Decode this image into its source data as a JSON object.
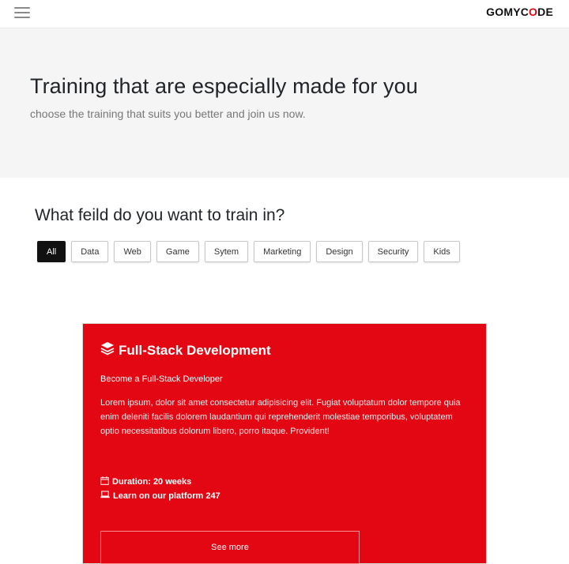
{
  "navbar": {
    "menu_icon": "hamburger-menu-icon",
    "brand_prefix": "GOMYC",
    "brand_highlight": "O",
    "brand_suffix": "DE",
    "brand_accent_color": "#e30613"
  },
  "hero": {
    "title": "Training that are especially made for you",
    "subtitle": "choose the training that suits you better and join us now."
  },
  "fields": {
    "title": "What feild do you want to train in?",
    "filters": [
      "All",
      "Data",
      "Web",
      "Game",
      "Sytem",
      "Marketing",
      "Design",
      "Security",
      "Kids"
    ],
    "active_filter": "All"
  },
  "course": {
    "icon": "layers-icon",
    "title": "Full-Stack Development",
    "subtitle": "Become a Full-Stack Developer",
    "description": "Lorem ipsum, dolor sit amet consectetur adipisicing elit. Fugiat voluptatum dolor tempore quia enim deleniti facilis dolorem laudantium qui reprehenderit molestiae temporibus, voluptatem optio necessitatibus dolorum libero, porro itaque. Provident!",
    "duration": "Duration: 20 weeks",
    "duration_icon": "calendar-icon",
    "platform": "Learn on our platform 247",
    "platform_icon": "laptop-icon",
    "button_label": "See more",
    "card_color": "#e30613"
  }
}
